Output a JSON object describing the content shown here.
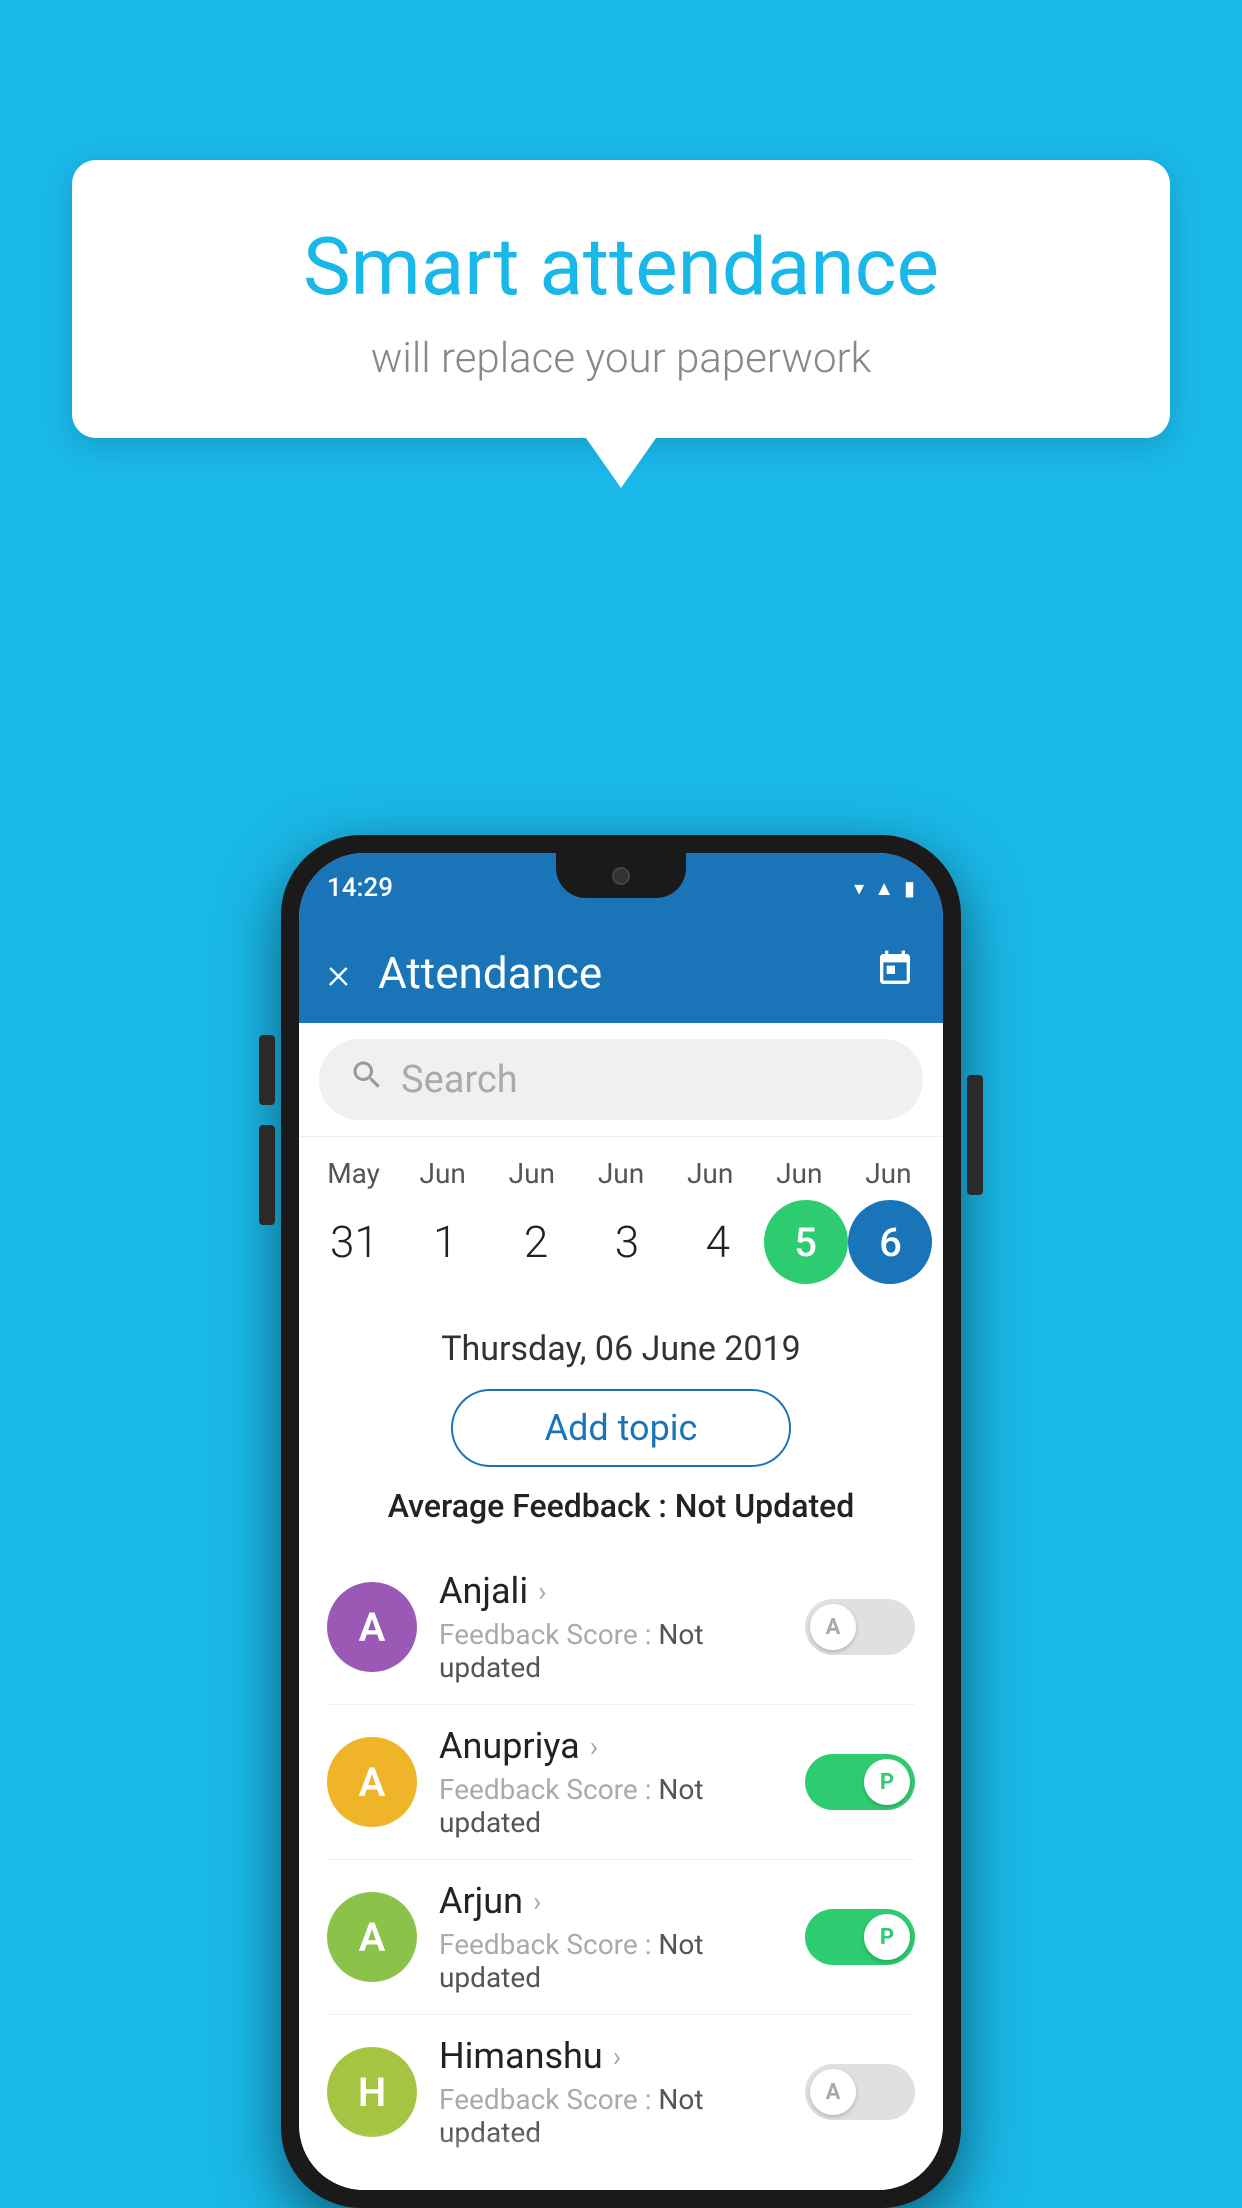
{
  "background": {
    "color": "#1ab8e8"
  },
  "bubble": {
    "title": "Smart attendance",
    "subtitle": "will replace your paperwork"
  },
  "phone": {
    "status_bar": {
      "time": "14:29",
      "wifi": "▼",
      "signal": "▲",
      "battery": "▮"
    },
    "app_bar": {
      "title": "Attendance",
      "close_label": "×",
      "calendar_icon": "calendar-icon"
    },
    "search": {
      "placeholder": "Search"
    },
    "calendar": {
      "months": [
        "May",
        "Jun",
        "Jun",
        "Jun",
        "Jun",
        "Jun",
        "Jun"
      ],
      "dates": [
        "31",
        "1",
        "2",
        "3",
        "4",
        "5",
        "6"
      ],
      "today_index": 5,
      "selected_index": 6
    },
    "selected_date_label": "Thursday, 06 June 2019",
    "add_topic_label": "Add topic",
    "avg_feedback_label": "Average Feedback :",
    "avg_feedback_value": "Not Updated",
    "students": [
      {
        "name": "Anjali",
        "avatar_letter": "A",
        "avatar_color": "#9b59b6",
        "feedback_label": "Feedback Score :",
        "feedback_value": "Not updated",
        "status": "absent",
        "toggle_label": "A"
      },
      {
        "name": "Anupriya",
        "avatar_letter": "A",
        "avatar_color": "#f0b429",
        "feedback_label": "Feedback Score :",
        "feedback_value": "Not updated",
        "status": "present",
        "toggle_label": "P"
      },
      {
        "name": "Arjun",
        "avatar_letter": "A",
        "avatar_color": "#8bc34a",
        "feedback_label": "Feedback Score :",
        "feedback_value": "Not updated",
        "status": "present",
        "toggle_label": "P"
      },
      {
        "name": "Himanshu",
        "avatar_letter": "H",
        "avatar_color": "#a5c442",
        "feedback_label": "Feedback Score :",
        "feedback_value": "Not updated",
        "status": "absent",
        "toggle_label": "A"
      }
    ]
  }
}
